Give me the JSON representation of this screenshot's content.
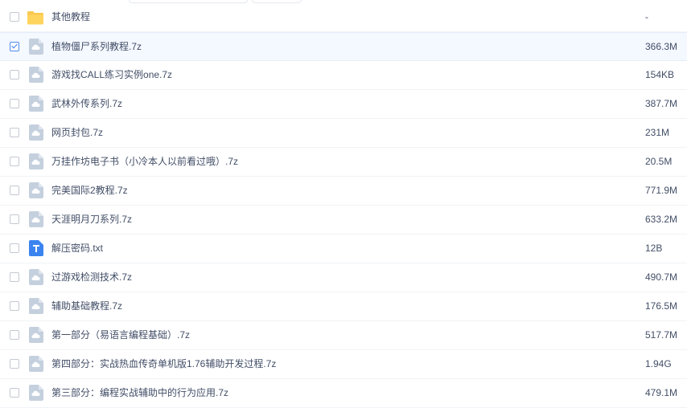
{
  "files": [
    {
      "name": "其他教程",
      "size": "-",
      "type": "folder",
      "checked": false
    },
    {
      "name": "植物僵尸系列教程.7z",
      "size": "366.3M",
      "type": "archive",
      "checked": true
    },
    {
      "name": "游戏找CALL练习实例one.7z",
      "size": "154KB",
      "type": "archive",
      "checked": false
    },
    {
      "name": "武林外传系列.7z",
      "size": "387.7M",
      "type": "archive",
      "checked": false
    },
    {
      "name": "网页封包.7z",
      "size": "231M",
      "type": "archive",
      "checked": false
    },
    {
      "name": "万挂作坊电子书（小冷本人以前看过哦）.7z",
      "size": "20.5M",
      "type": "archive",
      "checked": false
    },
    {
      "name": "完美国际2教程.7z",
      "size": "771.9M",
      "type": "archive",
      "checked": false
    },
    {
      "name": "天涯明月刀系列.7z",
      "size": "633.2M",
      "type": "archive",
      "checked": false
    },
    {
      "name": "解压密码.txt",
      "size": "12B",
      "type": "text",
      "checked": false
    },
    {
      "name": "过游戏检测技术.7z",
      "size": "490.7M",
      "type": "archive",
      "checked": false
    },
    {
      "name": "辅助基础教程.7z",
      "size": "176.5M",
      "type": "archive",
      "checked": false
    },
    {
      "name": "第一部分（易语言编程基础）.7z",
      "size": "517.7M",
      "type": "archive",
      "checked": false
    },
    {
      "name": "第四部分：实战热血传奇单机版1.76辅助开发过程.7z",
      "size": "1.94G",
      "type": "archive",
      "checked": false
    },
    {
      "name": "第三部分：编程实战辅助中的行为应用.7z",
      "size": "479.1M",
      "type": "archive",
      "checked": false
    }
  ],
  "colors": {
    "accent": "#3b80f0",
    "folder": "#fbc950",
    "archive": "#c5d0de",
    "text_file": "#3b84f0"
  }
}
